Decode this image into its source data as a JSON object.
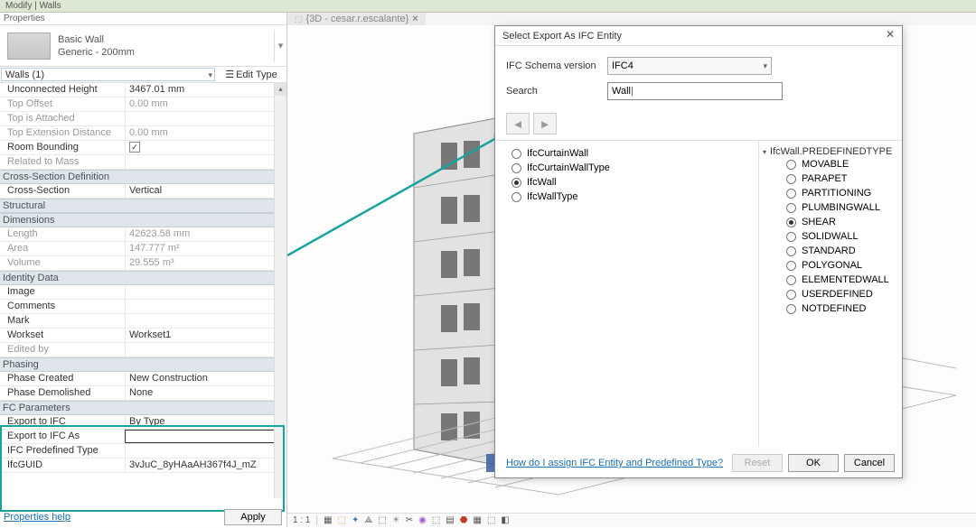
{
  "ribbon": {
    "path": "Modify | Walls"
  },
  "props": {
    "panel_title": "Properties",
    "family_name": "Basic Wall",
    "type_name": "Generic - 200mm",
    "filter_label": "Walls (1)",
    "edit_type": "Edit Type",
    "rows": [
      {
        "label": "Unconnected Height",
        "value": "3467.01 mm"
      },
      {
        "label": "Top Offset",
        "value": "0.00 mm",
        "disabled": true
      },
      {
        "label": "Top is Attached",
        "value": "",
        "disabled": true
      },
      {
        "label": "Top Extension Distance",
        "value": "0.00 mm",
        "disabled": true
      },
      {
        "label": "Room Bounding",
        "value": "check"
      },
      {
        "label": "Related to Mass",
        "value": "",
        "disabled": true
      }
    ],
    "groups": [
      {
        "name": "Cross-Section Definition",
        "rows": [
          {
            "label": "Cross-Section",
            "value": "Vertical"
          }
        ]
      },
      {
        "name": "Structural",
        "rows": []
      },
      {
        "name": "Dimensions",
        "rows": [
          {
            "label": "Length",
            "value": "42623.58 mm",
            "disabled": true
          },
          {
            "label": "Area",
            "value": "147.777 m²",
            "disabled": true
          },
          {
            "label": "Volume",
            "value": "29.555 m³",
            "disabled": true
          }
        ]
      },
      {
        "name": "Identity Data",
        "rows": [
          {
            "label": "Image",
            "value": ""
          },
          {
            "label": "Comments",
            "value": ""
          },
          {
            "label": "Mark",
            "value": ""
          },
          {
            "label": "Workset",
            "value": "Workset1"
          },
          {
            "label": "Edited by",
            "value": "",
            "disabled": true
          }
        ]
      },
      {
        "name": "Phasing",
        "rows": [
          {
            "label": "Phase Created",
            "value": "New Construction"
          },
          {
            "label": "Phase Demolished",
            "value": "None"
          }
        ]
      },
      {
        "name": "FC Parameters",
        "rows": [
          {
            "label": "Export to IFC",
            "value": "By Type"
          },
          {
            "label": "Export to IFC As",
            "value": "",
            "editing": true
          },
          {
            "label": "IFC Predefined Type",
            "value": ""
          },
          {
            "label": "IfcGUID",
            "value": "3vJuC_8yHAaAH367f4J_mZ"
          }
        ]
      }
    ],
    "footer_link": "Properties help",
    "apply": "Apply"
  },
  "viewport": {
    "tab_name": "{3D - cesar.r.escalante}",
    "scale": "1 : 1"
  },
  "dialog": {
    "title": "Select Export As IFC Entity",
    "schema_label": "IFC Schema version",
    "schema_value": "IFC4",
    "search_label": "Search",
    "search_value": "Wall",
    "left_options": [
      {
        "label": "IfcCurtainWall",
        "selected": false
      },
      {
        "label": "IfcCurtainWallType",
        "selected": false
      },
      {
        "label": "IfcWall",
        "selected": true
      },
      {
        "label": "IfcWallType",
        "selected": false
      }
    ],
    "right_header": "IfcWall.PREDEFINEDTYPE",
    "right_options": [
      {
        "label": "MOVABLE",
        "selected": false
      },
      {
        "label": "PARAPET",
        "selected": false
      },
      {
        "label": "PARTITIONING",
        "selected": false
      },
      {
        "label": "PLUMBINGWALL",
        "selected": false
      },
      {
        "label": "SHEAR",
        "selected": true
      },
      {
        "label": "SOLIDWALL",
        "selected": false
      },
      {
        "label": "STANDARD",
        "selected": false
      },
      {
        "label": "POLYGONAL",
        "selected": false
      },
      {
        "label": "ELEMENTEDWALL",
        "selected": false
      },
      {
        "label": "USERDEFINED",
        "selected": false
      },
      {
        "label": "NOTDEFINED",
        "selected": false
      }
    ],
    "help_link": "How do I assign IFC Entity and Predefined Type?",
    "reset": "Reset",
    "ok": "OK",
    "cancel": "Cancel"
  }
}
